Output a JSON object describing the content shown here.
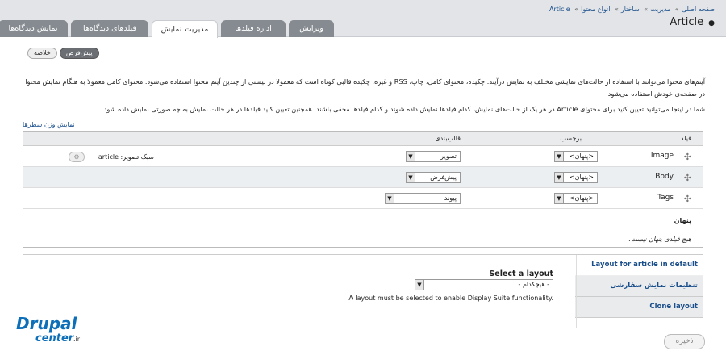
{
  "breadcrumb": [
    "صفحه اصلی",
    "مدیریت",
    "ساختار",
    "انواع محتوا",
    "Article"
  ],
  "title": "Article",
  "tabs": [
    "ویرایش",
    "اداره فیلدها",
    "مدیریت نمایش",
    "فیلدهای دیدگاه‌ها",
    "نمایش دیدگاه‌ها"
  ],
  "subtabs": [
    "پیش‌فرض",
    "خلاصه"
  ],
  "description": {
    "p1": "آیتم‌های محتوا می‌توانند با استفاده از حالت‌های نمایشی مختلف به نمایش درآیند: چکیده، محتوای کامل، چاپ، RSS و غیره. چکیده قالبی کوتاه است که معمولا در لیستی از چندین آیتم محتوا استفاده می‌شود. محتوای کامل معمولا به هنگام نمایش محتوا در صفحه‌ی خودش استفاده می‌شود.",
    "p2": "شما در اینجا می‌توانید تعیین کنید برای محتوای Article در هر یک از حالت‌های نمایش، کدام فیلدها نمایش داده شوند و کدام فیلدها مخفی باشند. همچنین تعیین کنید فیلدها در هر حالت نمایش به چه صورتی نمایش داده شود."
  },
  "row_weight_link": "نمایش وزن سطرها",
  "table": {
    "headers": {
      "field": "فیلد",
      "label": "برچسب",
      "format": "قالب‌بندی"
    },
    "rows": [
      {
        "field": "Image",
        "label": "<پنهان>",
        "format": "تصویر",
        "summary": "سبک تصویر: article"
      },
      {
        "field": "Body",
        "label": "<پنهان>",
        "format": "پیش‌فرض",
        "summary": ""
      },
      {
        "field": "Tags",
        "label": "<پنهان>",
        "format": "پیوند",
        "summary": ""
      }
    ],
    "hidden_title": "پنهان",
    "hidden_empty": "هیچ فیلدی پنهان نیست."
  },
  "layout": {
    "vtabs": [
      "Layout for article in default",
      "تنظیمات نمایش سفارشی",
      "Clone layout"
    ],
    "select_label": "Select a layout",
    "select_value": "- هیچکدام -",
    "help": "A layout must be selected to enable Display Suite functionality."
  },
  "logo": {
    "part1": "Drupal",
    "part2": "center",
    "tld": ".ir"
  },
  "save": "ذخیره",
  "colors": {
    "tab_bg": "#858b90",
    "link": "#1a4f8b",
    "header_bg": "#e2e4e7"
  }
}
